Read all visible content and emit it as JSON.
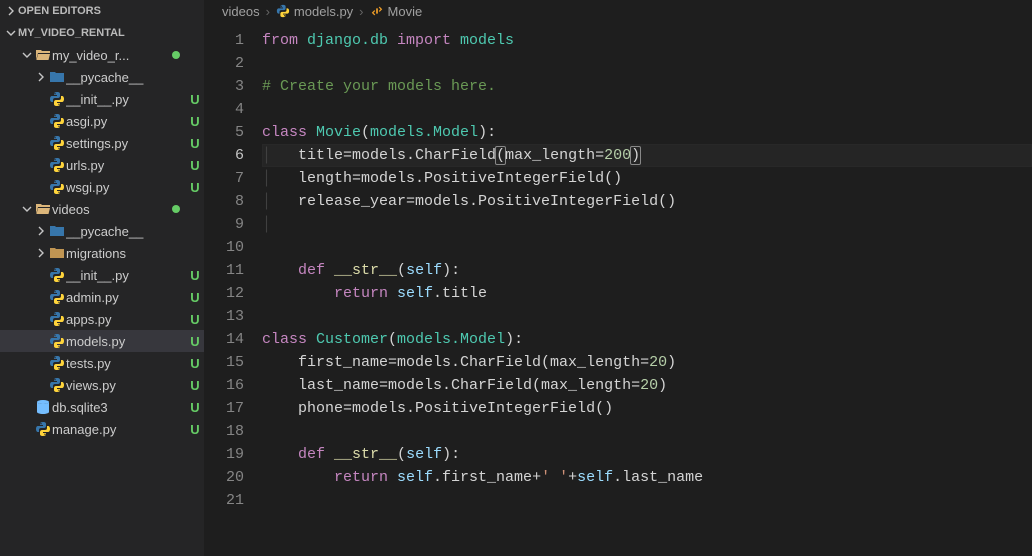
{
  "sidebar": {
    "open_editors_label": "OPEN EDITORS",
    "workspace_label": "MY_VIDEO_RENTAL",
    "tree": [
      {
        "depth": 1,
        "chev": "down",
        "iconType": "folder-open",
        "label": "my_video_r...",
        "dot": true,
        "status": "",
        "name": "folder-my-video-rental"
      },
      {
        "depth": 2,
        "chev": "right",
        "iconType": "folder-pkg",
        "label": "__pycache__",
        "status": "",
        "name": "folder-pycache"
      },
      {
        "depth": 2,
        "chev": "",
        "iconType": "py",
        "label": "__init__.py",
        "status": "U",
        "name": "file-init-py"
      },
      {
        "depth": 2,
        "chev": "",
        "iconType": "py",
        "label": "asgi.py",
        "status": "U",
        "name": "file-asgi-py"
      },
      {
        "depth": 2,
        "chev": "",
        "iconType": "py",
        "label": "settings.py",
        "status": "U",
        "name": "file-settings-py"
      },
      {
        "depth": 2,
        "chev": "",
        "iconType": "py",
        "label": "urls.py",
        "status": "U",
        "name": "file-urls-py"
      },
      {
        "depth": 2,
        "chev": "",
        "iconType": "py",
        "label": "wsgi.py",
        "status": "U",
        "name": "file-wsgi-py"
      },
      {
        "depth": 1,
        "chev": "down",
        "iconType": "folder-open-orange",
        "label": "videos",
        "dot": true,
        "status": "",
        "name": "folder-videos"
      },
      {
        "depth": 2,
        "chev": "right",
        "iconType": "folder-pkg",
        "label": "__pycache__",
        "status": "",
        "name": "folder-pycache-2"
      },
      {
        "depth": 2,
        "chev": "right",
        "iconType": "folder",
        "label": "migrations",
        "status": "",
        "name": "folder-migrations"
      },
      {
        "depth": 2,
        "chev": "",
        "iconType": "py",
        "label": "__init__.py",
        "status": "U",
        "name": "file-init-py-2"
      },
      {
        "depth": 2,
        "chev": "",
        "iconType": "py",
        "label": "admin.py",
        "status": "U",
        "name": "file-admin-py"
      },
      {
        "depth": 2,
        "chev": "",
        "iconType": "py",
        "label": "apps.py",
        "status": "U",
        "name": "file-apps-py"
      },
      {
        "depth": 2,
        "chev": "",
        "iconType": "py",
        "label": "models.py",
        "status": "U",
        "active": true,
        "name": "file-models-py"
      },
      {
        "depth": 2,
        "chev": "",
        "iconType": "py",
        "label": "tests.py",
        "status": "U",
        "name": "file-tests-py"
      },
      {
        "depth": 2,
        "chev": "",
        "iconType": "py",
        "label": "views.py",
        "status": "U",
        "name": "file-views-py"
      },
      {
        "depth": 1,
        "chev": "",
        "iconType": "db",
        "label": "db.sqlite3",
        "status": "U",
        "name": "file-db-sqlite3"
      },
      {
        "depth": 1,
        "chev": "",
        "iconType": "py",
        "label": "manage.py",
        "status": "U",
        "name": "file-manage-py"
      }
    ]
  },
  "breadcrumb": {
    "seg1": "videos",
    "seg2": "models.py",
    "seg3": "Movie"
  },
  "code": {
    "current_line": 6,
    "lines": [
      {
        "n": 1,
        "tokens": [
          {
            "t": "from ",
            "c": "kw"
          },
          {
            "t": "django.db ",
            "c": "mod"
          },
          {
            "t": "import ",
            "c": "kw"
          },
          {
            "t": "models",
            "c": "mod"
          }
        ]
      },
      {
        "n": 2,
        "tokens": []
      },
      {
        "n": 3,
        "tokens": [
          {
            "t": "# Create your models here.",
            "c": "cmt"
          }
        ]
      },
      {
        "n": 4,
        "tokens": []
      },
      {
        "n": 5,
        "tokens": [
          {
            "t": "class ",
            "c": "kw"
          },
          {
            "t": "Movie",
            "c": "cls"
          },
          {
            "t": "(",
            "c": "par"
          },
          {
            "t": "models.Model",
            "c": "mod"
          },
          {
            "t": "):",
            "c": "par"
          }
        ]
      },
      {
        "n": 6,
        "tokens": [
          {
            "t": "│   ",
            "c": "ind"
          },
          {
            "t": "title=models.CharField",
            "c": ""
          },
          {
            "t": "(",
            "c": "bhl"
          },
          {
            "t": "max_length=",
            "c": ""
          },
          {
            "t": "20",
            "c": "num"
          },
          {
            "t": "0",
            "c": "numcur"
          },
          {
            "t": ")",
            "c": "bhl"
          }
        ]
      },
      {
        "n": 7,
        "tokens": [
          {
            "t": "│   ",
            "c": "ind"
          },
          {
            "t": "length=models.PositiveIntegerField()",
            "c": ""
          }
        ]
      },
      {
        "n": 8,
        "tokens": [
          {
            "t": "│   ",
            "c": "ind"
          },
          {
            "t": "release_year=models.PositiveIntegerField()",
            "c": ""
          }
        ]
      },
      {
        "n": 9,
        "tokens": [
          {
            "t": "│   ",
            "c": "ind"
          }
        ]
      },
      {
        "n": 10,
        "tokens": []
      },
      {
        "n": 11,
        "tokens": [
          {
            "t": "    ",
            "c": ""
          },
          {
            "t": "def ",
            "c": "kw"
          },
          {
            "t": "__str__",
            "c": "fn"
          },
          {
            "t": "(",
            "c": "par"
          },
          {
            "t": "self",
            "c": "self"
          },
          {
            "t": "):",
            "c": "par"
          }
        ]
      },
      {
        "n": 12,
        "tokens": [
          {
            "t": "        ",
            "c": ""
          },
          {
            "t": "return ",
            "c": "kw"
          },
          {
            "t": "self",
            "c": "self"
          },
          {
            "t": ".title",
            "c": ""
          }
        ]
      },
      {
        "n": 13,
        "tokens": []
      },
      {
        "n": 14,
        "tokens": [
          {
            "t": "class ",
            "c": "kw"
          },
          {
            "t": "Customer",
            "c": "cls"
          },
          {
            "t": "(",
            "c": "par"
          },
          {
            "t": "models.Model",
            "c": "mod"
          },
          {
            "t": "):",
            "c": "par"
          }
        ]
      },
      {
        "n": 15,
        "tokens": [
          {
            "t": "    ",
            "c": ""
          },
          {
            "t": "first_name=models.CharField(max_length=",
            "c": ""
          },
          {
            "t": "20",
            "c": "num"
          },
          {
            "t": ")",
            "c": ""
          }
        ]
      },
      {
        "n": 16,
        "tokens": [
          {
            "t": "    ",
            "c": ""
          },
          {
            "t": "last_name=models.CharField(max_length=",
            "c": ""
          },
          {
            "t": "20",
            "c": "num"
          },
          {
            "t": ")",
            "c": ""
          }
        ]
      },
      {
        "n": 17,
        "tokens": [
          {
            "t": "    ",
            "c": ""
          },
          {
            "t": "phone=models.PositiveIntegerField()",
            "c": ""
          }
        ]
      },
      {
        "n": 18,
        "tokens": []
      },
      {
        "n": 19,
        "tokens": [
          {
            "t": "    ",
            "c": ""
          },
          {
            "t": "def ",
            "c": "kw"
          },
          {
            "t": "__str__",
            "c": "fn"
          },
          {
            "t": "(",
            "c": "par"
          },
          {
            "t": "self",
            "c": "self"
          },
          {
            "t": "):",
            "c": "par"
          }
        ]
      },
      {
        "n": 20,
        "tokens": [
          {
            "t": "        ",
            "c": ""
          },
          {
            "t": "return ",
            "c": "kw"
          },
          {
            "t": "self",
            "c": "self"
          },
          {
            "t": ".first_name+",
            "c": ""
          },
          {
            "t": "' '",
            "c": "str"
          },
          {
            "t": "+",
            "c": ""
          },
          {
            "t": "self",
            "c": "self"
          },
          {
            "t": ".last_name",
            "c": ""
          }
        ]
      },
      {
        "n": 21,
        "tokens": []
      }
    ]
  }
}
